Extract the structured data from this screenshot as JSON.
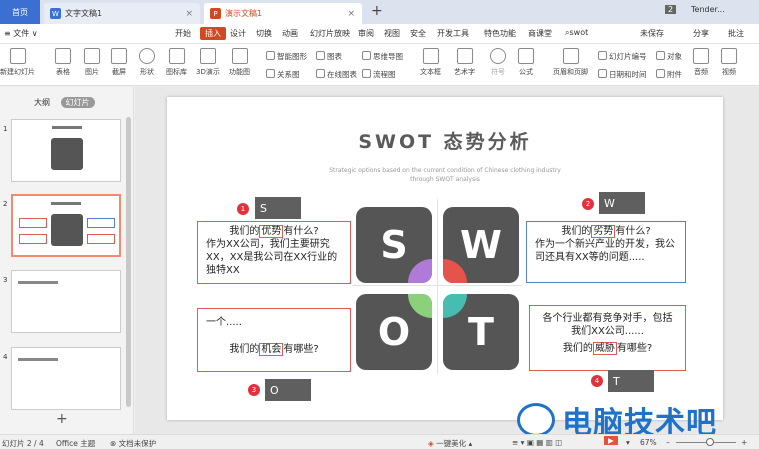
{
  "tabs": {
    "home": "首页",
    "doc": "文字文稿1",
    "ppt": "演示文稿1",
    "badge": "2",
    "account": "Tender..."
  },
  "menu": [
    "文件",
    "开始",
    "插入",
    "设计",
    "切换",
    "动画",
    "幻灯片放映",
    "审阅",
    "视图",
    "安全",
    "开发工具",
    "特色功能",
    "商课堂"
  ],
  "menu_active": "插入",
  "search": "swot",
  "right_menu": {
    "sync": "未保存",
    "share": "分享",
    "comment": "批注"
  },
  "toolbar": {
    "new_slide": "新建幻灯片",
    "table": "表格",
    "picture": "图片",
    "screenshot": "截屏",
    "shape": "形状",
    "icon_lib": "图标库",
    "3d": "3D演示",
    "func_chart": "功能图",
    "smart": "智能图形",
    "chart": "图表",
    "mind": "思维导图",
    "textbox": "文本框",
    "art": "艺术字",
    "symbol": "符号",
    "formula": "公式",
    "relation": "关系图",
    "online_chart": "在线图表",
    "flow": "流程图",
    "header": "页眉和页脚",
    "slide_num": "幻灯片编号",
    "object": "对象",
    "datetime": "日期和时间",
    "attach": "附件",
    "audio": "音频",
    "video": "视频"
  },
  "sidebar": {
    "outline": "大纲",
    "slides": "幻灯片",
    "nums": [
      "1",
      "2",
      "3",
      "4"
    ],
    "add": "+"
  },
  "slide": {
    "title": "SWOT 态势分析",
    "subtitle": "Strategic options based on the current condition of Chinese clothing industry through SWOT analysis",
    "letters": [
      "S",
      "W",
      "O",
      "T"
    ],
    "labels": {
      "s": "S",
      "w": "W",
      "o": "O",
      "t": "T"
    },
    "nums": [
      "1",
      "2",
      "3",
      "4"
    ],
    "s_q": {
      "pre": "我们的",
      "hl": "优势",
      "post": "有什么?"
    },
    "s_body": "作为XX公司，我们主要研究XX，XX是我公司在XX行业的独特XX",
    "w_q": {
      "pre": "我们的",
      "hl": "劣势",
      "post": "有什么?"
    },
    "w_body": "作为一个新兴产业的开发，我公司还具有XX等的问题.....",
    "o_body": "一个.....",
    "o_q": {
      "pre": "我们的",
      "hl": "机会",
      "post": "有哪些?"
    },
    "t_body": "各个行业都有竞争对手，包括我们XX公司......",
    "t_q": {
      "pre": "我们的",
      "hl": "威胁",
      "post": "有哪些?"
    }
  },
  "status": {
    "page": "幻灯片 2 / 4",
    "theme": "Office 主题",
    "protect": "文档未保护",
    "beautify": "一键美化",
    "zoom": "67%"
  },
  "watermark": "电脑技术吧",
  "colors": {
    "accent": "#d04a21",
    "square": "#555555",
    "purple": "#b07bd8",
    "red": "#e5534b",
    "teal": "#46bdb0",
    "green": "#8bd07a"
  }
}
